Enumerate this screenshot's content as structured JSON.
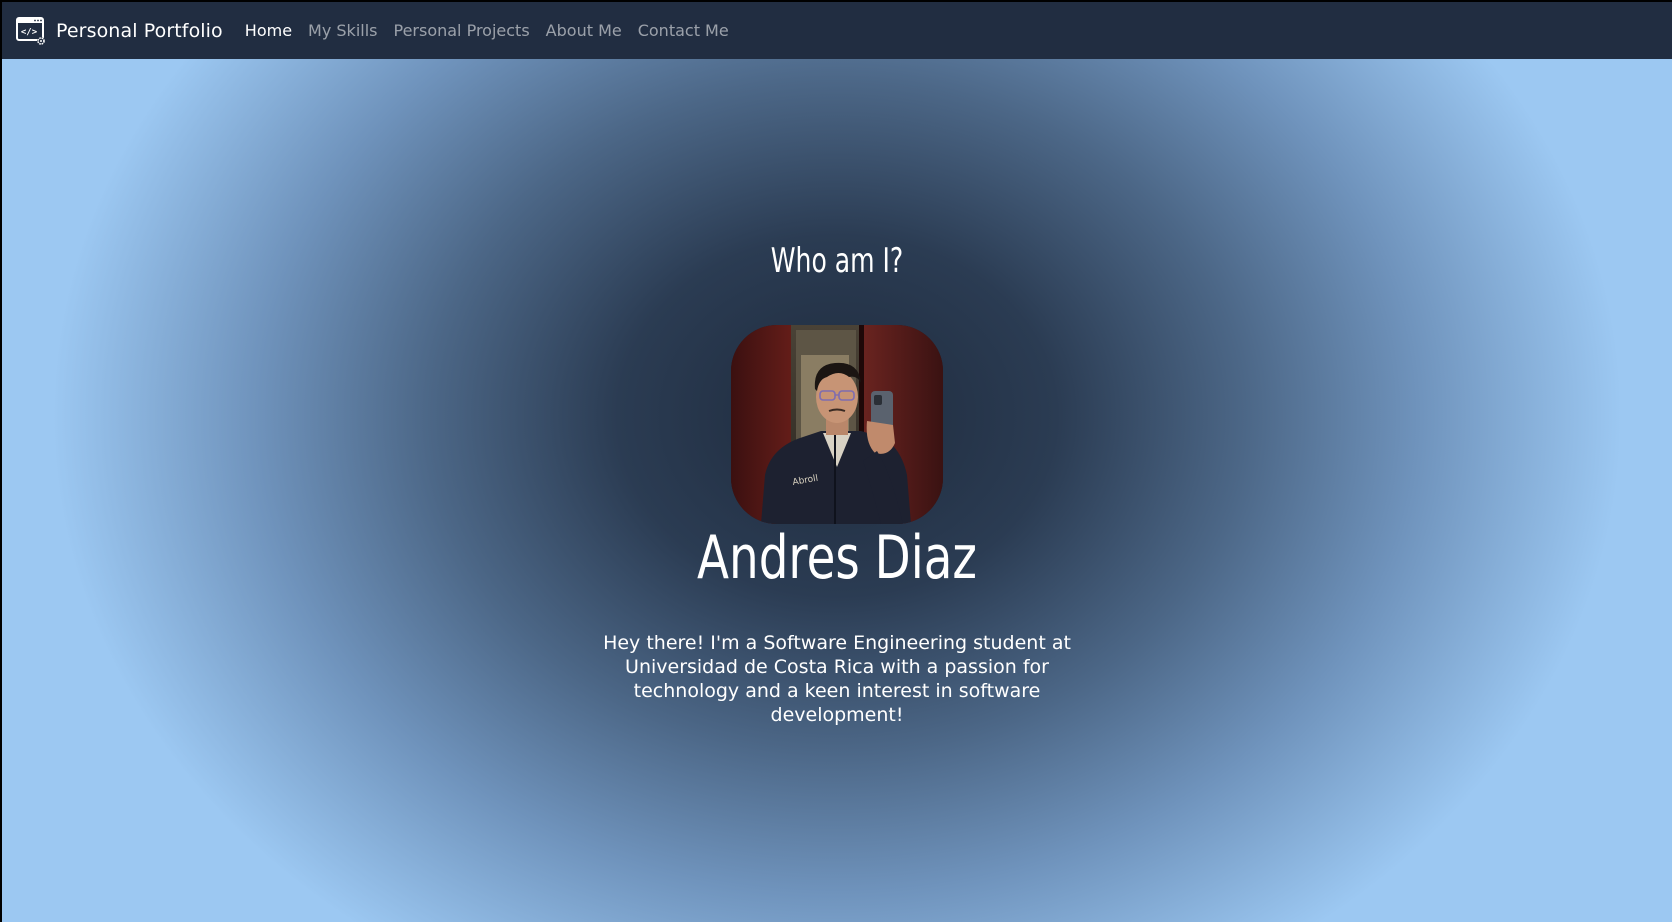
{
  "navbar": {
    "brand_icon": "code-window-gear-icon",
    "brand_label": "Personal Portfolio",
    "links": [
      {
        "label": "Home",
        "active": true
      },
      {
        "label": "My Skills",
        "active": false
      },
      {
        "label": "Personal Projects",
        "active": false
      },
      {
        "label": "About Me",
        "active": false
      },
      {
        "label": "Contact Me",
        "active": false
      }
    ]
  },
  "hero": {
    "heading": "Who am I?",
    "photo": "profile-photo-mirror-selfie",
    "name": "Andres Diaz",
    "bio": "Hey there! I'm a Software Engineering student at Universidad de Costa Rica with a passion for technology and a keen interest in software development!"
  },
  "colors": {
    "navbar_bg": "#212d41",
    "center_dark": "#1e2a3c",
    "edge_light": "#9cc8f2",
    "text": "#ffffff",
    "nav_inactive": "rgba(255,255,255,0.55)"
  }
}
